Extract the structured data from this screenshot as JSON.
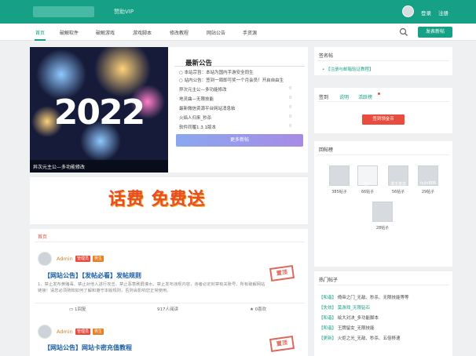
{
  "header": {
    "vip_label": "赞助VIP",
    "login": "登录",
    "register": "注册"
  },
  "nav": {
    "items": [
      "首页",
      "破解软件",
      "破解游戏",
      "游戏脚本",
      "修改教程",
      "网站公告",
      "手资源"
    ],
    "active_index": 0,
    "post_button": "发表新帖"
  },
  "hero": {
    "year": "2022",
    "caption": "异次元主公—多功能修改"
  },
  "announcements": {
    "title": "最新公告",
    "items": [
      {
        "label": "本站宗旨：",
        "text": "本站为国内手游安全同生"
      },
      {
        "label": "站内公告：",
        "text": "签到一周即可奖一个月会员！开启自由生"
      },
      {
        "label": "",
        "text": "异次元主公—多功能修改"
      },
      {
        "label": "",
        "text": "地灵曲—无限技能"
      },
      {
        "label": "",
        "text": "最新微信资源平台网站消息帖"
      },
      {
        "label": "",
        "text": "火焰人归来_秒杀"
      },
      {
        "label": "",
        "text": "软件同履1.3.1版本"
      }
    ],
    "counts": [
      "0",
      "0",
      "0",
      "0",
      "0"
    ],
    "more_button": "更多新帖"
  },
  "banner": {
    "text": "话费 免费送"
  },
  "feed": {
    "breadcrumb": "首页",
    "posts": [
      {
        "author": "Admin",
        "badges": [
          "管理员",
          "男生"
        ],
        "tag": "【网站公告】",
        "title": "【发帖必看】发帖规则",
        "excerpt": "1、禁止发布黄赌毒、禁止对他人进行攻击、禁止恶意刷屏灌水、禁止发布违规内容，违者必定封禁有关账号、所有破解网站链接！请您必须熟知如何了解和遵守本版规则，否则会影响您正常使用。",
        "stamp": "置顶",
        "replies": "1回复",
        "views": "917人阅读",
        "likes": "0喜欢"
      },
      {
        "author": "Admin",
        "badges": [
          "管理员",
          "男生"
        ],
        "tag": "【网站公告】",
        "title": "网站卡密充值教程",
        "stamp": "置顶"
      }
    ]
  },
  "sidebar": {
    "sign_title": "签名帖",
    "sign_link": "【注册与邮箱验证教程】",
    "checkin_tabs": [
      "签到",
      "说明",
      "活跃榜"
    ],
    "checkin_button": "签到领金币",
    "leaderboard_title": "回帖榜",
    "leaders": [
      {
        "name": "",
        "count": "385帖子"
      },
      {
        "name": "画户",
        "count": "66帖子"
      },
      {
        "name": "漫主苗苗",
        "count": "56帖子"
      },
      {
        "name": "fyjin888",
        "count": "29帖子"
      },
      {
        "name": "",
        "count": "28帖子"
      }
    ],
    "hot_title": "热门帖子",
    "hot": [
      {
        "cat": "【和谐】",
        "text": "倚帝之门_无敌、秒杀、无限技能等等"
      },
      {
        "cat": "【失效】",
        "text": "莫游戏_无限钻石"
      },
      {
        "cat": "【和谐】",
        "text": "绘大对决_多功能脚本"
      },
      {
        "cat": "【和谐】",
        "text": "王牌留女_无限技能"
      },
      {
        "cat": "【更新】",
        "text": "火炬之光_无敌、秒杀、五倍移速"
      }
    ]
  },
  "colors": {
    "brand": "#16a085",
    "accent_red": "#e84c3d",
    "link_blue": "#1a5fa8",
    "author_orange": "#e67e22"
  }
}
